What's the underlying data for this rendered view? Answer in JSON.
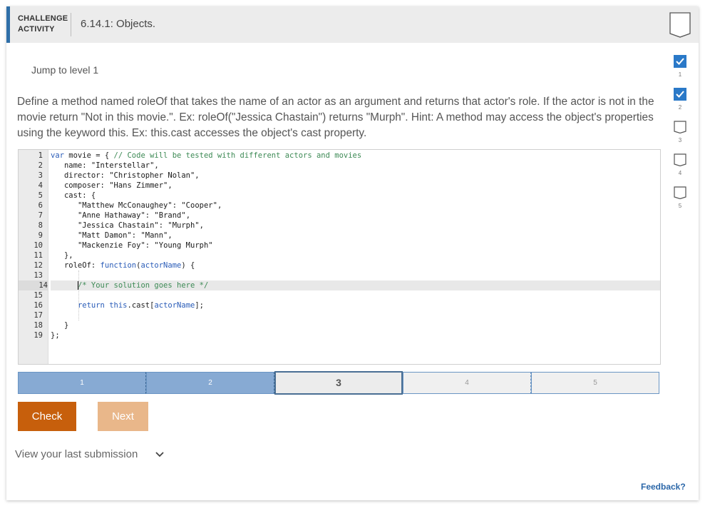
{
  "header": {
    "label_line1": "CHALLENGE",
    "label_line2": "ACTIVITY",
    "title": "6.14.1: Objects."
  },
  "jump_text": "Jump to level 1",
  "prompt": "Define a method named roleOf that takes the name of an actor as an argument and returns that actor's role. If the actor is not in the movie return \"Not in this movie.\". Ex: roleOf(\"Jessica Chastain\") returns \"Murph\". Hint: A method may access the object's properties using the keyword this. Ex: this.cast accesses the object's cast property.",
  "editor": {
    "line_numbers": [
      "1",
      "2",
      "3",
      "4",
      "5",
      "6",
      "7",
      "8",
      "9",
      "10",
      "11",
      "12",
      "13",
      "14",
      "15",
      "16",
      "17",
      "18",
      "19"
    ],
    "active_line": 14,
    "lines": [
      "var movie = { // Code will be tested with different actors and movies",
      "   name: \"Interstellar\",",
      "   director: \"Christopher Nolan\",",
      "   composer: \"Hans Zimmer\",",
      "   cast: {",
      "      \"Matthew McConaughey\": \"Cooper\",",
      "      \"Anne Hathaway\": \"Brand\",",
      "      \"Jessica Chastain\": \"Murph\",",
      "      \"Matt Damon\": \"Mann\",",
      "      \"Mackenzie Foy\": \"Young Murph\"",
      "   },",
      "   roleOf: function(actorName) {",
      "",
      "      /* Your solution goes here */",
      "",
      "      return this.cast[actorName];",
      "",
      "   }",
      "};"
    ]
  },
  "progress": {
    "segments": [
      "1",
      "2",
      "3",
      "4",
      "5"
    ],
    "current": 3,
    "completed": 2
  },
  "buttons": {
    "check": "Check",
    "next": "Next"
  },
  "view_submission": "View your last submission",
  "feedback": "Feedback?",
  "levels": {
    "labels": [
      "1",
      "2",
      "3",
      "4",
      "5"
    ],
    "checked": [
      true,
      true,
      false,
      false,
      false
    ]
  },
  "colors": {
    "accent": "#2f6fa8",
    "check_button": "#c75f0c",
    "next_button": "#e9b78a",
    "progress_done": "#87aad3",
    "level_checked": "#2a79c8"
  },
  "icons": {
    "bookmark": "bookmark-icon",
    "chevron": "chevron-down-icon",
    "level_checked": "checkbox-checked-icon",
    "level_unchecked": "checkbox-unchecked-icon"
  }
}
